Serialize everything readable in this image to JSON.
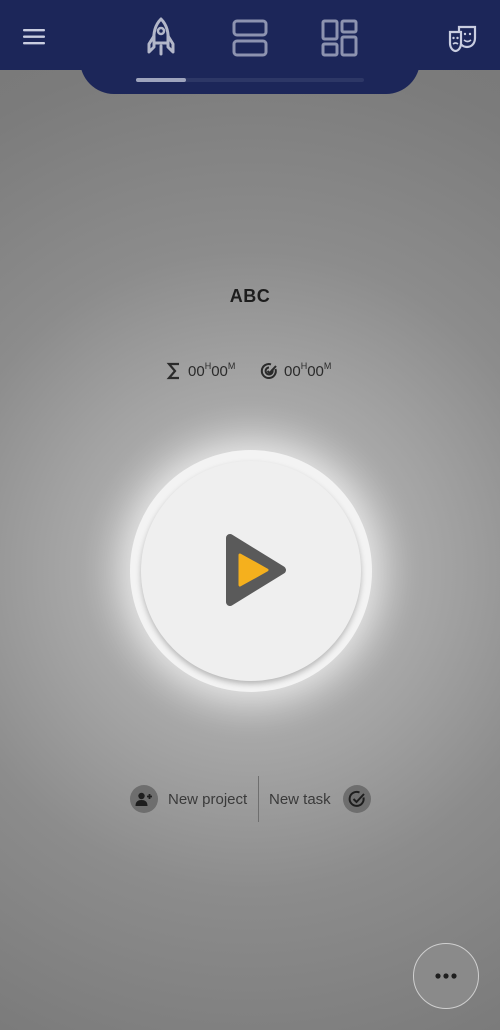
{
  "header": {
    "menu_icon": "hamburger-menu-icon",
    "theater_icon": "theater-masks-icon",
    "tabs": [
      {
        "icon": "rocket-icon",
        "active": true
      },
      {
        "icon": "two-rows-icon",
        "active": false
      },
      {
        "icon": "dashboard-grid-icon",
        "active": false
      }
    ]
  },
  "main": {
    "project_name": "ABC",
    "stats": {
      "total": {
        "icon": "sigma-icon",
        "hours": "00",
        "hour_unit": "H",
        "minutes": "00",
        "minute_unit": "M"
      },
      "goal": {
        "icon": "target-check-icon",
        "hours": "00",
        "hour_unit": "H",
        "minutes": "00",
        "minute_unit": "M"
      }
    },
    "play": {
      "icon": "play-icon",
      "accent": "#f5b01d"
    }
  },
  "actions": {
    "new_project_label": "New project",
    "new_task_label": "New task"
  },
  "fab": {
    "icon": "more-horizontal-icon"
  },
  "colors": {
    "header": "#1c2659",
    "accent": "#f5b01d",
    "icon_dark": "#5a5a5a"
  }
}
